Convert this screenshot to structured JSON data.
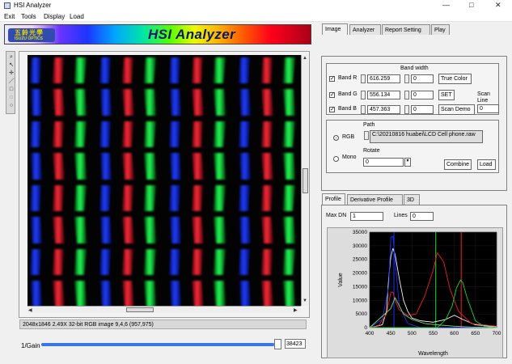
{
  "window": {
    "title": "HSI Analyzer",
    "controls": [
      "—",
      "□",
      "✕"
    ]
  },
  "menu": [
    "Exit",
    "Tools",
    "Display",
    "Load"
  ],
  "banner": {
    "logo_cn": "五鈴光學",
    "logo_en": "ISUZU OPTICS",
    "title": "HSI Analyzer"
  },
  "toolbar": {
    "icons": [
      "zoom-icon",
      "cursor-icon",
      "crosshair-icon",
      "line-icon",
      "rectangle-icon",
      "lasso-icon",
      "circle-icon"
    ]
  },
  "image": {
    "info": "2048x1846 2.49X 32-bit RGB image 9,4,6     (957,975)"
  },
  "gain": {
    "label": "1/Gain",
    "value": "38423",
    "fraction": 0.98
  },
  "tabs": [
    {
      "label": "Image",
      "active": true
    },
    {
      "label": "Analyzer",
      "active": false
    },
    {
      "label": "Report Setting",
      "active": false
    },
    {
      "label": "Play",
      "active": false
    }
  ],
  "bands": {
    "bandwidth_label": "Band width",
    "rows": [
      {
        "label": "Band R",
        "value": "616.259",
        "width": "0",
        "button": "True Color"
      },
      {
        "label": "Band G",
        "value": "556.134",
        "width": "0",
        "button": "SET"
      },
      {
        "label": "Band B",
        "value": "457.363",
        "width": "0",
        "button": "Scan Demo"
      }
    ],
    "scan_line_label": "Scan Line",
    "scan_line_value": "0"
  },
  "file": {
    "path_label": "Path",
    "path_value": "C:\\20210816 huabei\\LCD Cell phone.raw",
    "rgb_label": "RGB",
    "mono_label": "Mono",
    "rotate_label": "Rotate",
    "rotate_value": "0",
    "combine_label": "Combine",
    "load_label": "Load"
  },
  "profile_tabs": [
    {
      "label": "Profile",
      "active": true
    },
    {
      "label": "Derivative Profile",
      "active": false
    },
    {
      "label": "3D",
      "active": false
    }
  ],
  "profile": {
    "max_dn_label": "Max DN",
    "max_dn_value": "1",
    "lines_label": "Lines",
    "lines_value": "0"
  },
  "colors": {
    "red": "#ff1d2a",
    "green": "#13e236",
    "blue": "#1a35ff",
    "slider": "#3976e8"
  },
  "chart_data": {
    "type": "line",
    "xlabel": "Wavelength",
    "ylabel": "Value",
    "xlim": [
      400,
      700
    ],
    "ylim": [
      0,
      35000
    ],
    "x_ticks": [
      400,
      450,
      500,
      550,
      600,
      650,
      700
    ],
    "y_ticks": [
      0,
      5000,
      10000,
      15000,
      20000,
      25000,
      30000,
      35000
    ],
    "grid": true,
    "markers": [
      {
        "x": 457.363,
        "color": "#1a35ff"
      },
      {
        "x": 556.134,
        "color": "#13e236"
      },
      {
        "x": 616.259,
        "color": "#ff1d2a"
      }
    ],
    "series": [
      {
        "color": "#ffffff",
        "x": [
          400,
          430,
          440,
          445,
          450,
          455,
          460,
          470,
          480,
          490,
          500,
          520,
          550,
          580,
          600,
          620,
          650,
          700
        ],
        "y": [
          0,
          1000,
          6000,
          18000,
          26000,
          29000,
          27000,
          18000,
          10000,
          6000,
          3500,
          2500,
          2000,
          3000,
          4500,
          3000,
          1000,
          300
        ]
      },
      {
        "color": "#ff1d2a",
        "x": [
          400,
          420,
          440,
          450,
          455,
          460,
          470,
          490,
          510,
          530,
          550,
          560,
          575,
          590,
          610,
          640,
          700
        ],
        "y": [
          0,
          500,
          5000,
          13000,
          13000,
          10000,
          6500,
          4500,
          5000,
          11500,
          21000,
          27500,
          24000,
          14000,
          6000,
          1500,
          500
        ]
      },
      {
        "color": "#1a35ff",
        "x": [
          400,
          430,
          445,
          450,
          455,
          460,
          470,
          490,
          520,
          700
        ],
        "y": [
          0,
          3000,
          15000,
          33000,
          33500,
          25000,
          8000,
          1500,
          0,
          0
        ]
      },
      {
        "color": "#13e236",
        "x": [
          400,
          560,
          580,
          595,
          605,
          615,
          620,
          630,
          650,
          670,
          700
        ],
        "y": [
          0,
          0,
          3000,
          8000,
          14500,
          17500,
          16500,
          11000,
          2500,
          500,
          0
        ]
      },
      {
        "color": "#7be96e",
        "x": [
          400,
          450,
          460,
          480,
          500,
          530,
          560,
          600,
          640,
          700
        ],
        "y": [
          0,
          7000,
          11000,
          5000,
          3000,
          1500,
          1000,
          500,
          200,
          0
        ]
      }
    ]
  }
}
